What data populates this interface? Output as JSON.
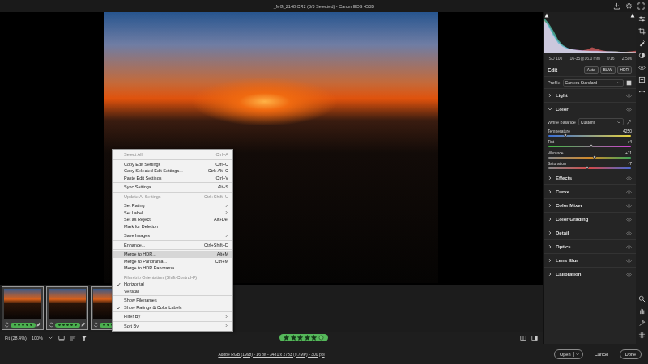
{
  "window": {
    "title": "_MG_2148.CR2 (3/3 Selected) - Canon EOS 450D"
  },
  "histogram": {
    "series": [
      {
        "name": "red",
        "color": "#d94848",
        "values": [
          90,
          70,
          45,
          25,
          15,
          10,
          8,
          7,
          6,
          8,
          14,
          10,
          6,
          4,
          3,
          3,
          2,
          2,
          3,
          5
        ]
      },
      {
        "name": "green",
        "color": "#3fbf9f",
        "values": [
          95,
          80,
          60,
          35,
          20,
          12,
          8,
          6,
          5,
          5,
          4,
          4,
          3,
          3,
          3,
          3,
          2,
          2,
          2,
          1
        ]
      },
      {
        "name": "blue",
        "color": "#4a66d8",
        "values": [
          85,
          75,
          50,
          30,
          18,
          12,
          9,
          7,
          6,
          5,
          5,
          5,
          4,
          3,
          3,
          2,
          2,
          1,
          1,
          1
        ]
      }
    ]
  },
  "camera_info": [
    "ISO 100",
    "16-35@16.0 mm",
    "f/16",
    "2.50s"
  ],
  "edit": {
    "title": "Edit",
    "modes": [
      {
        "label": "Auto",
        "selected": false
      },
      {
        "label": "B&W",
        "selected": false
      },
      {
        "label": "HDR",
        "selected": false
      }
    ]
  },
  "profile": {
    "label": "Profile",
    "value": "Camera Standard"
  },
  "sections": [
    {
      "title": "Light",
      "expanded": false
    },
    {
      "title": "Color",
      "expanded": true
    },
    {
      "title": "Effects",
      "expanded": false
    },
    {
      "title": "Curve",
      "expanded": false
    },
    {
      "title": "Color Mixer",
      "expanded": false
    },
    {
      "title": "Color Grading",
      "expanded": false
    },
    {
      "title": "Detail",
      "expanded": false
    },
    {
      "title": "Optics",
      "expanded": false
    },
    {
      "title": "Lens Blur",
      "expanded": false
    },
    {
      "title": "Calibration",
      "expanded": false
    }
  ],
  "color_panel": {
    "white_balance": {
      "label": "White balance",
      "value": "Custom"
    },
    "sliders": [
      {
        "name": "Temperature",
        "reading": "4250",
        "level": 0.21,
        "kind": "temperature"
      },
      {
        "name": "Tint",
        "reading": "+4",
        "level": 0.52,
        "kind": "tint"
      },
      {
        "name": "Vibrance",
        "reading": "+11",
        "level": 0.56,
        "kind": "vibrance"
      },
      {
        "name": "Saturation",
        "reading": "-7",
        "level": 0.47,
        "kind": "saturation"
      }
    ]
  },
  "filmstrip": [
    {
      "selected": true,
      "stars": 5
    },
    {
      "selected": true,
      "stars": 5
    },
    {
      "selected": true,
      "stars": 5
    }
  ],
  "toolbar": {
    "zoom": [
      {
        "label": "Fit (28.4%)",
        "selected": true
      },
      {
        "label": "100%",
        "selected": false
      }
    ],
    "rating": {
      "stars": 5
    }
  },
  "footer": {
    "info": "Adobe RGB (1998) - 16 bit - 3481 x 2783 (9.7MP) - 300 ppi",
    "buttons": [
      {
        "label": "Open",
        "kind": "split"
      },
      {
        "label": "Cancel",
        "kind": "plain"
      },
      {
        "label": "Done",
        "kind": "outline"
      }
    ]
  },
  "context_menu": {
    "groups": [
      [
        {
          "label": "Select All",
          "shortcut": "Ctrl+A",
          "disabled": true,
          "checked": false,
          "submenu": false,
          "selected": false
        }
      ],
      [
        {
          "label": "Copy Edit Settings",
          "shortcut": "Ctrl+C",
          "disabled": false,
          "checked": false,
          "submenu": false,
          "selected": false
        },
        {
          "label": "Copy Selected Edit Settings...",
          "shortcut": "Ctrl+Alt+C",
          "disabled": false,
          "checked": false,
          "submenu": false,
          "selected": false
        },
        {
          "label": "Paste Edit Settings",
          "shortcut": "Ctrl+V",
          "disabled": false,
          "checked": false,
          "submenu": false,
          "selected": false
        }
      ],
      [
        {
          "label": "Sync Settings...",
          "shortcut": "Alt+S",
          "disabled": false,
          "checked": false,
          "submenu": false,
          "selected": false
        }
      ],
      [
        {
          "label": "Update AI Settings",
          "shortcut": "Ctrl+Shift+U",
          "disabled": true,
          "checked": false,
          "submenu": false,
          "selected": false
        }
      ],
      [
        {
          "label": "Set Rating",
          "shortcut": "",
          "disabled": false,
          "checked": false,
          "submenu": true,
          "selected": false
        },
        {
          "label": "Set Label",
          "shortcut": "",
          "disabled": false,
          "checked": false,
          "submenu": true,
          "selected": false
        },
        {
          "label": "Set as Reject",
          "shortcut": "Alt+Del",
          "disabled": false,
          "checked": false,
          "submenu": false,
          "selected": false
        },
        {
          "label": "Mark for Deletion",
          "shortcut": "",
          "disabled": false,
          "checked": false,
          "submenu": false,
          "selected": false
        }
      ],
      [
        {
          "label": "Save Images",
          "shortcut": "",
          "disabled": false,
          "checked": false,
          "submenu": true,
          "selected": false
        }
      ],
      [
        {
          "label": "Enhance...",
          "shortcut": "Ctrl+Shift+D",
          "disabled": false,
          "checked": false,
          "submenu": false,
          "selected": false
        }
      ],
      [
        {
          "label": "Merge to HDR...",
          "shortcut": "Alt+M",
          "disabled": false,
          "checked": false,
          "submenu": false,
          "selected": true
        },
        {
          "label": "Merge to Panorama...",
          "shortcut": "Ctrl+M",
          "disabled": false,
          "checked": false,
          "submenu": false,
          "selected": false
        },
        {
          "label": "Merge to HDR Panorama...",
          "shortcut": "",
          "disabled": false,
          "checked": false,
          "submenu": false,
          "selected": false
        }
      ],
      [
        {
          "label": "Filmstrip Orientation (Shift-Control-F)",
          "shortcut": "",
          "disabled": true,
          "checked": false,
          "submenu": false,
          "selected": false
        },
        {
          "label": "Horizontal",
          "shortcut": "",
          "disabled": false,
          "checked": true,
          "submenu": false,
          "selected": false
        },
        {
          "label": "Vertical",
          "shortcut": "",
          "disabled": false,
          "checked": false,
          "submenu": false,
          "selected": false
        }
      ],
      [
        {
          "label": "Show Filenames",
          "shortcut": "",
          "disabled": false,
          "checked": false,
          "submenu": false,
          "selected": false
        },
        {
          "label": "Show Ratings & Color Labels",
          "shortcut": "",
          "disabled": false,
          "checked": true,
          "submenu": false,
          "selected": false
        }
      ],
      [
        {
          "label": "Filter By",
          "shortcut": "",
          "disabled": false,
          "checked": false,
          "submenu": true,
          "selected": false
        }
      ],
      [
        {
          "label": "Sort By",
          "shortcut": "",
          "disabled": false,
          "checked": false,
          "submenu": true,
          "selected": false
        }
      ]
    ]
  }
}
